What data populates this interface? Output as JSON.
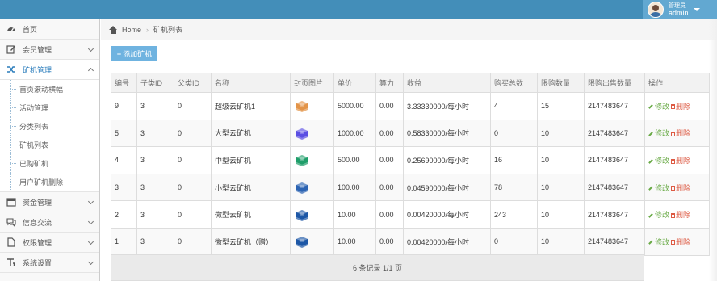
{
  "topbar": {
    "user": {
      "welcome": "管理员",
      "name": "admin"
    }
  },
  "sidebar": {
    "items": [
      {
        "label": "首页",
        "icon": "dashboard-icon"
      },
      {
        "label": "会员管理",
        "icon": "edit-icon"
      },
      {
        "label": "矿机管理",
        "icon": "shuffle-icon",
        "active": true
      },
      {
        "label": "资金管理",
        "icon": "calendar-icon"
      },
      {
        "label": "信息交流",
        "icon": "comments-icon"
      },
      {
        "label": "权限管理",
        "icon": "file-icon"
      },
      {
        "label": "系统设置",
        "icon": "text-icon"
      }
    ],
    "submenu": [
      "首页滚动横幅",
      "活动管理",
      "分类列表",
      "矿机列表",
      "已购矿机",
      "用户矿机删除"
    ]
  },
  "breadcrumb": {
    "home": "Home",
    "current": "矿机列表"
  },
  "toolbar": {
    "add_label": "添加矿机"
  },
  "table": {
    "headers": [
      "编号",
      "子类ID",
      "父类ID",
      "名称",
      "封页图片",
      "单价",
      "算力",
      "收益",
      "购买总数",
      "限购数量",
      "限购出售数量",
      "操作"
    ],
    "rows": [
      {
        "id": "9",
        "sub": "3",
        "parent": "0",
        "name": "超级云矿机1",
        "chip": "#e39448",
        "price": "5000.00",
        "power": "0.00",
        "income": "3.33330000/每小时",
        "total": "4",
        "limit": "15",
        "sell": "2147483647"
      },
      {
        "id": "5",
        "sub": "3",
        "parent": "0",
        "name": "大型云矿机",
        "chip": "#5b4fe3",
        "price": "1000.00",
        "power": "0.00",
        "income": "0.58330000/每小时",
        "total": "0",
        "limit": "10",
        "sell": "2147483647"
      },
      {
        "id": "4",
        "sub": "3",
        "parent": "0",
        "name": "中型云矿机",
        "chip": "#1f9e6a",
        "price": "500.00",
        "power": "0.00",
        "income": "0.25690000/每小时",
        "total": "16",
        "limit": "10",
        "sell": "2147483647"
      },
      {
        "id": "3",
        "sub": "3",
        "parent": "0",
        "name": "小型云矿机",
        "chip": "#2c64b3",
        "price": "100.00",
        "power": "0.00",
        "income": "0.04590000/每小时",
        "total": "78",
        "limit": "10",
        "sell": "2147483647"
      },
      {
        "id": "2",
        "sub": "3",
        "parent": "0",
        "name": "微型云矿机",
        "chip": "#1d57a6",
        "price": "10.00",
        "power": "0.00",
        "income": "0.00420000/每小时",
        "total": "243",
        "limit": "10",
        "sell": "2147483647"
      },
      {
        "id": "1",
        "sub": "3",
        "parent": "0",
        "name": "微型云矿机（赠）",
        "chip": "#1d57a6",
        "price": "10.00",
        "power": "0.00",
        "income": "0.00420000/每小时",
        "total": "0",
        "limit": "10",
        "sell": "2147483647"
      }
    ],
    "edit_label": "修改",
    "delete_label": "删除"
  },
  "pagination": {
    "summary": "6 条记录 1/1 页"
  }
}
